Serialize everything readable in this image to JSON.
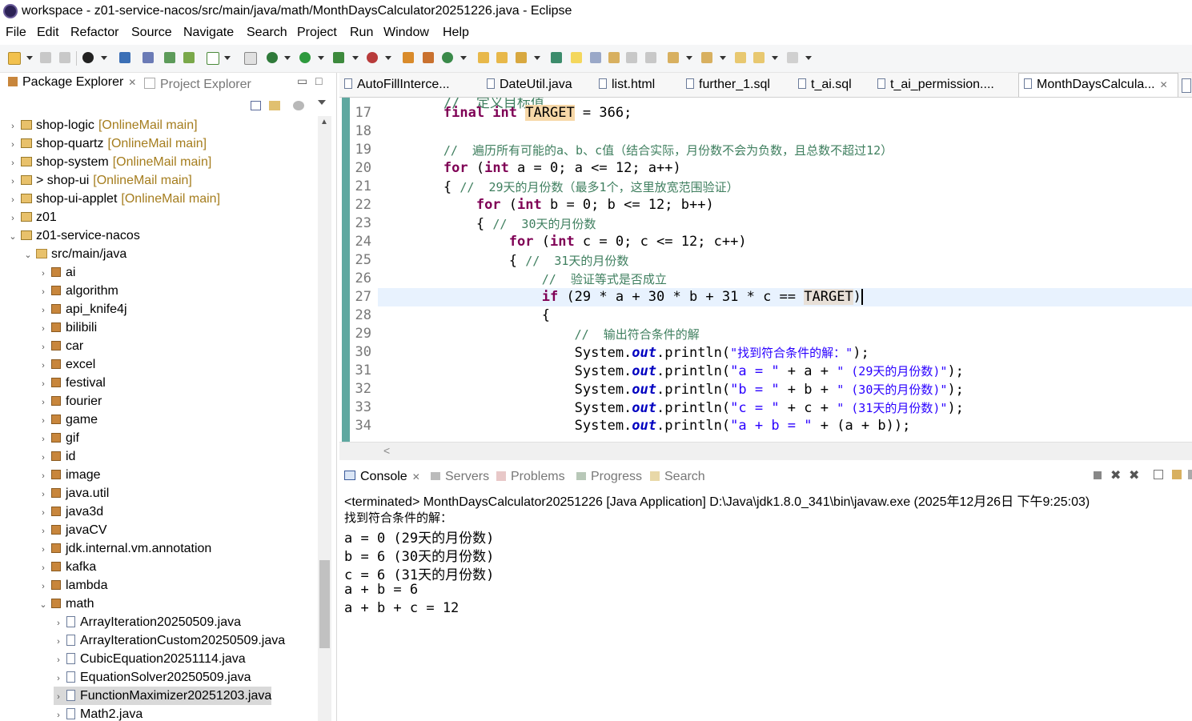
{
  "window": {
    "title": "workspace - z01-service-nacos/src/main/java/math/MonthDaysCalculator20251226.java - Eclipse"
  },
  "menu": [
    "File",
    "Edit",
    "Refactor",
    "Source",
    "Navigate",
    "Search",
    "Project",
    "Run",
    "Window",
    "Help"
  ],
  "left_panel": {
    "tab_active": "Package Explorer",
    "tab_inactive": "Project Explorer",
    "tree": [
      {
        "label": "shop-logic",
        "decor": "[OnlineMail main]",
        "kind": "project",
        "level": 0,
        "open": false
      },
      {
        "label": "shop-quartz",
        "decor": "[OnlineMail main]",
        "kind": "project",
        "level": 0,
        "open": false
      },
      {
        "label": "shop-system",
        "decor": "[OnlineMail main]",
        "kind": "project",
        "level": 0,
        "open": false
      },
      {
        "label": "> shop-ui",
        "decor": "[OnlineMail main]",
        "kind": "project",
        "level": 0,
        "open": false
      },
      {
        "label": "shop-ui-applet",
        "decor": "[OnlineMail main]",
        "kind": "project",
        "level": 0,
        "open": false
      },
      {
        "label": "z01",
        "decor": "",
        "kind": "project",
        "level": 0,
        "open": false
      },
      {
        "label": "z01-service-nacos",
        "decor": "",
        "kind": "project",
        "level": 0,
        "open": true
      },
      {
        "label": "src/main/java",
        "decor": "",
        "kind": "src",
        "level": 1,
        "open": true
      },
      {
        "label": "ai",
        "decor": "",
        "kind": "package",
        "level": 2,
        "open": false
      },
      {
        "label": "algorithm",
        "decor": "",
        "kind": "package",
        "level": 2,
        "open": false
      },
      {
        "label": "api_knife4j",
        "decor": "",
        "kind": "package",
        "level": 2,
        "open": false
      },
      {
        "label": "bilibili",
        "decor": "",
        "kind": "package",
        "level": 2,
        "open": false
      },
      {
        "label": "car",
        "decor": "",
        "kind": "package",
        "level": 2,
        "open": false
      },
      {
        "label": "excel",
        "decor": "",
        "kind": "package",
        "level": 2,
        "open": false
      },
      {
        "label": "festival",
        "decor": "",
        "kind": "package",
        "level": 2,
        "open": false
      },
      {
        "label": "fourier",
        "decor": "",
        "kind": "package",
        "level": 2,
        "open": false
      },
      {
        "label": "game",
        "decor": "",
        "kind": "package",
        "level": 2,
        "open": false
      },
      {
        "label": "gif",
        "decor": "",
        "kind": "package",
        "level": 2,
        "open": false
      },
      {
        "label": "id",
        "decor": "",
        "kind": "package",
        "level": 2,
        "open": false
      },
      {
        "label": "image",
        "decor": "",
        "kind": "package",
        "level": 2,
        "open": false
      },
      {
        "label": "java.util",
        "decor": "",
        "kind": "package",
        "level": 2,
        "open": false
      },
      {
        "label": "java3d",
        "decor": "",
        "kind": "package",
        "level": 2,
        "open": false
      },
      {
        "label": "javaCV",
        "decor": "",
        "kind": "package",
        "level": 2,
        "open": false
      },
      {
        "label": "jdk.internal.vm.annotation",
        "decor": "",
        "kind": "package",
        "level": 2,
        "open": false
      },
      {
        "label": "kafka",
        "decor": "",
        "kind": "package",
        "level": 2,
        "open": false
      },
      {
        "label": "lambda",
        "decor": "",
        "kind": "package",
        "level": 2,
        "open": false
      },
      {
        "label": "math",
        "decor": "",
        "kind": "package",
        "level": 2,
        "open": true
      },
      {
        "label": "ArrayIteration20250509.java",
        "decor": "",
        "kind": "file",
        "level": 3,
        "open": false
      },
      {
        "label": "ArrayIterationCustom20250509.java",
        "decor": "",
        "kind": "file",
        "level": 3,
        "open": false
      },
      {
        "label": "CubicEquation20251114.java",
        "decor": "",
        "kind": "file",
        "level": 3,
        "open": false
      },
      {
        "label": "EquationSolver20250509.java",
        "decor": "",
        "kind": "file",
        "level": 3,
        "open": false
      },
      {
        "label": "FunctionMaximizer20251203.java",
        "decor": "",
        "kind": "file",
        "level": 3,
        "open": false,
        "selected": true
      },
      {
        "label": "Math2.java",
        "decor": "",
        "kind": "file",
        "level": 3,
        "open": false
      }
    ]
  },
  "editor": {
    "tabs": [
      "AutoFillInterce...",
      "DateUtil.java",
      "list.html",
      "further_1.sql",
      "t_ai.sql",
      "t_ai_permission....",
      "MonthDaysCalcula..."
    ],
    "active_tab": "MonthDaysCalcula...",
    "line_numbers": [
      "17",
      "18",
      "19",
      "20",
      "21",
      "22",
      "23",
      "24",
      "25",
      "26",
      "27",
      "28",
      "29",
      "30",
      "31",
      "32",
      "33",
      "34"
    ],
    "code": {
      "l17_kw": "final int",
      "l17_const": "TARGET",
      "l17_rest": " = 366;",
      "l19_comment": "//  遍历所有可能的a、b、c值（结合实际，月份数不会为负数，且总数不超过12）",
      "l20_kw_for": "for",
      "l20_kw_int": "int",
      "l20_rest": " a = 0; a <= 12; a++)",
      "l21_brace": "{ ",
      "l21_comment": "//  29天的月份数（最多1个，这里放宽范围验证）",
      "l22_rest": " b = 0; b <= 12; b++)",
      "l23_comment": "//  30天的月份数",
      "l24_rest": " c = 0; c <= 12; c++)",
      "l25_comment": "//  31天的月份数",
      "l26_comment": "//  验证等式是否成立",
      "l27_kw": "if",
      "l27_mid": "(29 * a + 30 * b + 31 * c == ",
      "l27_const": "TARGET",
      "l27_end": ")",
      "l28": "{",
      "l29_comment": "//  输出符合条件的解",
      "sys": "System.",
      "out": "out",
      "println": ".println(",
      "l30_str": "\"找到符合条件的解：\"",
      "l30_end": ");",
      "l31_str1": "\"a = \"",
      "l31_mid": " + a + ",
      "l31_str2": "\" (29天的月份数)\"",
      "l32_str1": "\"b = \"",
      "l32_mid": " + b + ",
      "l32_str2": "\" (30天的月份数)\"",
      "l33_str1": "\"c = \"",
      "l33_mid": " + c + ",
      "l33_str2": "\" (31天的月份数)\"",
      "l34_str1": "\"a + b = \"",
      "l34_end": " + (a + b));"
    }
  },
  "console": {
    "tabs": [
      "Console",
      "Servers",
      "Problems",
      "Progress",
      "Search"
    ],
    "header": "<terminated> MonthDaysCalculator20251226 [Java Application] D:\\Java\\jdk1.8.0_341\\bin\\javaw.exe (2025年12月26日 下午9:25:03)",
    "lines": [
      "找到符合条件的解：",
      "a = 0 (29天的月份数)",
      "b = 6 (30天的月份数)",
      "c = 6 (31天的月份数)",
      "a + b = 6",
      "a + b + c = 12"
    ]
  },
  "colors": {
    "keyword": "#7f0055",
    "comment": "#3f7f5f",
    "string": "#2a00ff",
    "field": "#0000c0",
    "decorator": "#a57d1e"
  }
}
